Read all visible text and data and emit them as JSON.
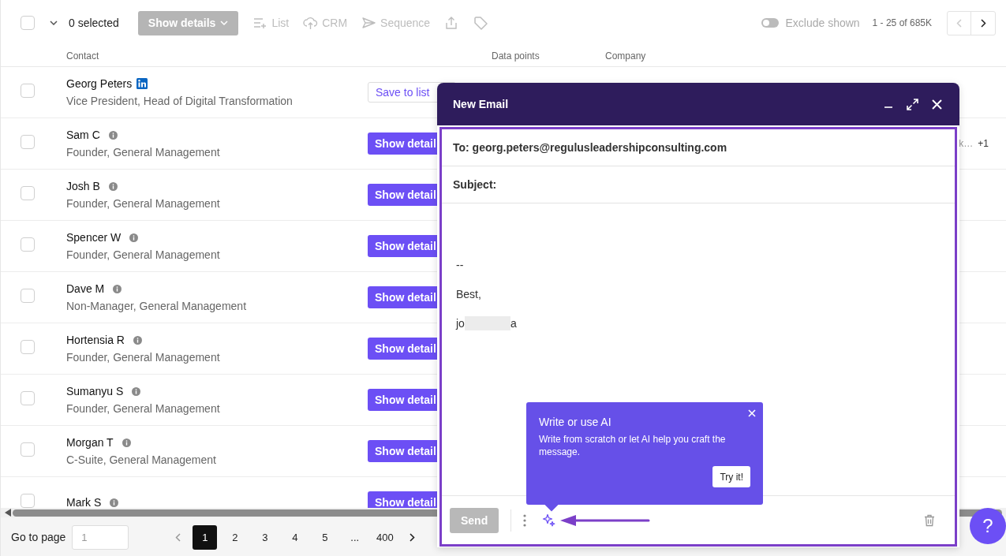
{
  "toolbar": {
    "select_all": {
      "checked": false
    },
    "selected_count": "0 selected",
    "show_details": {
      "label": "Show details",
      "disabled": true
    },
    "actions": [
      {
        "kind": "list",
        "label": "List",
        "disabled": true
      },
      {
        "kind": "crm",
        "label": "CRM",
        "disabled": true
      },
      {
        "kind": "sequence",
        "label": "Sequence",
        "disabled": true
      },
      {
        "kind": "export",
        "disabled": true
      },
      {
        "kind": "tag",
        "disabled": true
      }
    ],
    "exclude_shown": {
      "label": "Exclude shown",
      "on": false
    },
    "range": "1 - 25 of 685K",
    "prev_disabled": true,
    "next_disabled": false
  },
  "table": {
    "columns": [
      "Contact",
      "Data points",
      "Company"
    ],
    "rows": [
      {
        "checked": false,
        "name": "Georg Peters",
        "kind": "linkedin",
        "title": "Vice President, Head of Digital Transformation",
        "action": {
          "kind": "outline",
          "label": "Save to list"
        }
      },
      {
        "checked": false,
        "name": "Sam C",
        "kind": "info",
        "title": "Founder, General Management",
        "action": {
          "kind": "filled",
          "label": "Show detail"
        },
        "company_tail": "k…",
        "company_more": "+1"
      },
      {
        "checked": false,
        "name": "Josh B",
        "kind": "info",
        "title": "Founder, General Management",
        "action": {
          "kind": "filled",
          "label": "Show detail"
        }
      },
      {
        "checked": false,
        "name": "Spencer W",
        "kind": "info",
        "title": "Founder, General Management",
        "action": {
          "kind": "filled",
          "label": "Show detail"
        }
      },
      {
        "checked": false,
        "name": "Dave M",
        "kind": "info",
        "title": "Non-Manager, General Management",
        "action": {
          "kind": "filled",
          "label": "Show detail"
        }
      },
      {
        "checked": false,
        "name": "Hortensia R",
        "kind": "info",
        "title": "Founder, General Management",
        "action": {
          "kind": "filled",
          "label": "Show detail"
        }
      },
      {
        "checked": false,
        "name": "Sumanyu S",
        "kind": "info",
        "title": "Founder, General Management",
        "action": {
          "kind": "filled",
          "label": "Show detail"
        }
      },
      {
        "checked": false,
        "name": "Morgan T",
        "kind": "info",
        "title": "C-Suite, General Management",
        "action": {
          "kind": "filled",
          "label": "Show detail"
        }
      },
      {
        "checked": false,
        "name": "Mark S",
        "kind": "info",
        "action": {
          "kind": "filled",
          "label": "Show detail"
        }
      }
    ]
  },
  "pagination": {
    "goto_label": "Go to page",
    "goto_placeholder": "1",
    "pages": [
      {
        "label": "1",
        "selected": true
      },
      {
        "label": "2",
        "selected": false
      },
      {
        "label": "3",
        "selected": false
      },
      {
        "label": "4",
        "selected": false
      },
      {
        "label": "5",
        "selected": false
      },
      {
        "label": "...",
        "selected": false
      },
      {
        "label": "400",
        "selected": false
      }
    ]
  },
  "email": {
    "title": "New Email",
    "to": "To: georg.peters@regulusleadershipconsulting.com",
    "subject": "Subject:",
    "body": [
      "--",
      "Best,"
    ],
    "signature_start": "jo",
    "signature_end": "a",
    "send": {
      "label": "Send",
      "disabled": true
    },
    "tooltip": {
      "title": "Write or use AI",
      "text": "Write from scratch or let AI help you craft the message.",
      "button": "Try it!"
    }
  },
  "help": {
    "label": "?"
  }
}
